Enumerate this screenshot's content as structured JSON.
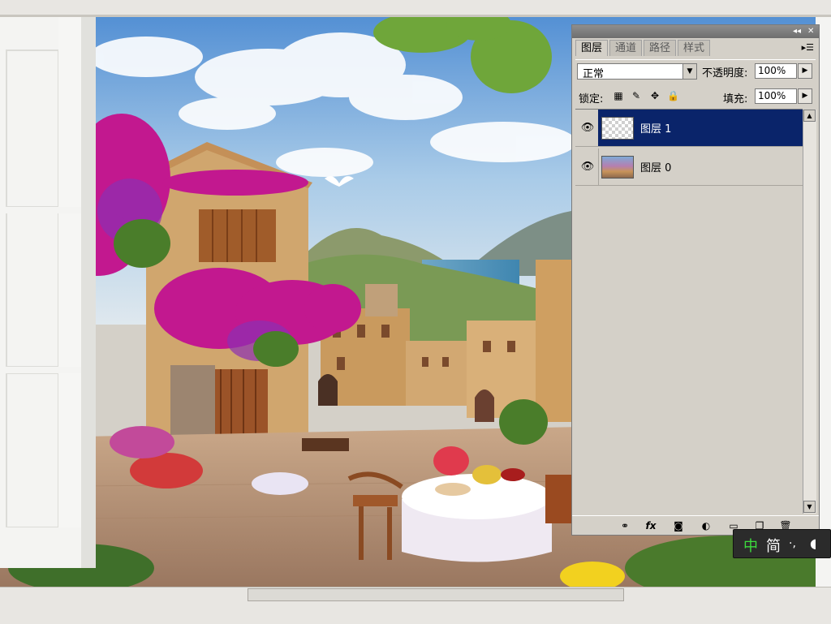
{
  "panel": {
    "tabs": [
      "图层",
      "通道",
      "路径",
      "样式"
    ],
    "title_buttons": [
      "◂◂",
      "✕"
    ],
    "menu_icon": "panel-menu-icon",
    "blend_mode": "正常",
    "opacity_label": "不透明度:",
    "opacity_value": "100%",
    "lock_label": "锁定:",
    "fill_label": "填充:",
    "fill_value": "100%",
    "layers": [
      {
        "name": "图层 1",
        "selected": true,
        "visible": true
      },
      {
        "name": "图层 0",
        "selected": false,
        "visible": true
      }
    ],
    "footer_icons": [
      "link-layers-icon",
      "fx-icon",
      "layer-mask-icon",
      "adjustment-layer-icon",
      "new-group-icon",
      "new-layer-icon",
      "trash-icon"
    ],
    "footer_text": {
      "fx": "fx"
    }
  },
  "ime": {
    "mode": "中",
    "mode2": "简",
    "punct": "·,"
  },
  "colors": {
    "selected_layer": "#0a246a",
    "panel_bg": "#d4d0c8",
    "ime_bg": "#2b2b2b",
    "ime_green": "#3ddc3d"
  }
}
